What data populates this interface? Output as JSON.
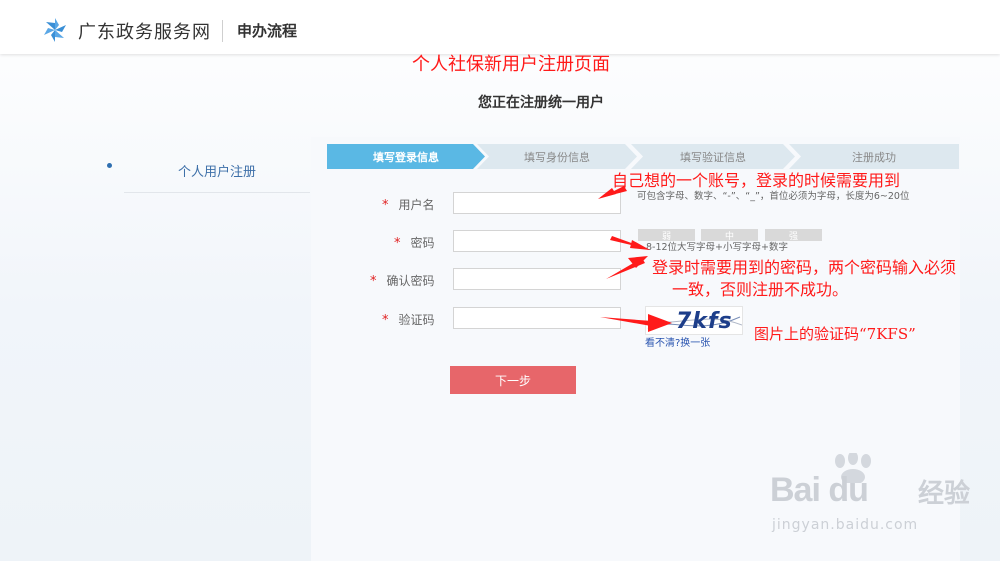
{
  "header": {
    "site_name": "广东政务服务网",
    "section": "申办流程",
    "logo_icon": "pinwheel-logo-icon",
    "brand_color": "#3a8fd6"
  },
  "page_title_annotation": "个人社保新用户注册页面",
  "subtitle": "您正在注册统一用户",
  "sidebar": {
    "items": [
      {
        "label": "个人用户注册"
      }
    ]
  },
  "steps": [
    {
      "label": "填写登录信息",
      "active": true
    },
    {
      "label": "填写身份信息",
      "active": false
    },
    {
      "label": "填写验证信息",
      "active": false
    },
    {
      "label": "注册成功",
      "active": false
    }
  ],
  "form": {
    "required_mark": "*",
    "username": {
      "label": "用户名",
      "value": "",
      "hint": "可包含字母、数字、“-”、“_”，首位必须为字母，长度为6~20位"
    },
    "password": {
      "label": "密码",
      "value": "",
      "strength": [
        "弱",
        "中",
        "强"
      ],
      "hint": "8-12位大写字母+小写字母+数字"
    },
    "confirm": {
      "label": "确认密码",
      "value": ""
    },
    "captcha": {
      "label": "验证码",
      "value": "",
      "image_text": "7kfs",
      "refresh": "看不清?换一张"
    },
    "next_button": "下一步"
  },
  "annotations": {
    "username_note": "自己想的一个账号，登录的时候需要用到",
    "password_note_1": "登录时需要用到的密码，两个密码输入必须",
    "password_note_2": "一致，否则注册不成功。",
    "captcha_note": "图片上的验证码“7KFS”",
    "color": "#ff1a1a"
  },
  "watermark": {
    "brand": "Bai du",
    "jingyan": "经验",
    "url": "jingyan.baidu.com"
  },
  "colors": {
    "active_step": "#5ab8e4",
    "inactive_step": "#dde8ef",
    "next_button": "#e7666a"
  }
}
